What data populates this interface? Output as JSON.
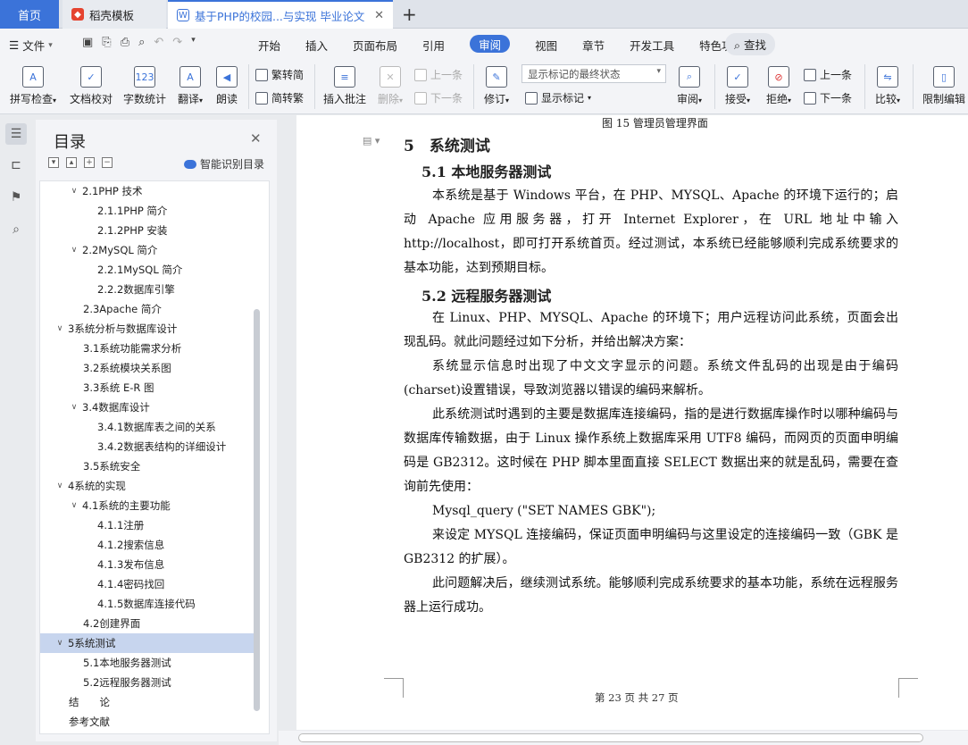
{
  "tabs": {
    "home": "首页",
    "template": "稻壳模板",
    "doc": "基于PHP的校园...与实现 毕业论文"
  },
  "menu": {
    "file": "文件",
    "items": [
      "开始",
      "插入",
      "页面布局",
      "引用",
      "审阅",
      "视图",
      "章节",
      "开发工具",
      "特色功能"
    ],
    "active_index": 4,
    "search": "查找"
  },
  "ribbon": {
    "spell": "拼写检查",
    "proof": "文档校对",
    "count": "字数统计",
    "translate": "翻译",
    "read": "朗读",
    "trad": "繁转简",
    "simp": "简转繁",
    "insert_comment": "插入批注",
    "delete": "删除",
    "prev_comment": "上一条",
    "next_comment": "下一条",
    "revise": "修订",
    "markup_state": "显示标记的最终状态",
    "show_markup": "显示标记",
    "review": "审阅",
    "accept": "接受",
    "reject": "拒绝",
    "prev_change": "上一条",
    "next_change": "下一条",
    "compare": "比较",
    "restrict": "限制编辑"
  },
  "toc": {
    "title": "目录",
    "smart": "智能识别目录",
    "items": [
      {
        "label": "2.1PHP 技术",
        "level": 2,
        "chev": true
      },
      {
        "label": "2.1.1PHP 简介",
        "level": 3,
        "chev": false
      },
      {
        "label": "2.1.2PHP 安装",
        "level": 3,
        "chev": false
      },
      {
        "label": "2.2MySQL 简介",
        "level": 2,
        "chev": true
      },
      {
        "label": "2.2.1MySQL 简介",
        "level": 3,
        "chev": false
      },
      {
        "label": "2.2.2数据库引擎",
        "level": 3,
        "chev": false
      },
      {
        "label": "2.3Apache 简介",
        "level": 2,
        "chev": false
      },
      {
        "label": "3系统分析与数据库设计",
        "level": 1,
        "chev": true
      },
      {
        "label": "3.1系统功能需求分析",
        "level": 2,
        "chev": false
      },
      {
        "label": "3.2系统模块关系图",
        "level": 2,
        "chev": false
      },
      {
        "label": "3.3系统 E-R 图",
        "level": 2,
        "chev": false
      },
      {
        "label": "3.4数据库设计",
        "level": 2,
        "chev": true
      },
      {
        "label": "3.4.1数据库表之间的关系",
        "level": 3,
        "chev": false
      },
      {
        "label": "3.4.2数据表结构的详细设计",
        "level": 3,
        "chev": false
      },
      {
        "label": "3.5系统安全",
        "level": 2,
        "chev": false
      },
      {
        "label": "4系统的实现",
        "level": 1,
        "chev": true
      },
      {
        "label": "4.1系统的主要功能",
        "level": 2,
        "chev": true
      },
      {
        "label": "4.1.1注册",
        "level": 3,
        "chev": false
      },
      {
        "label": "4.1.2搜索信息",
        "level": 3,
        "chev": false
      },
      {
        "label": "4.1.3发布信息",
        "level": 3,
        "chev": false
      },
      {
        "label": "4.1.4密码找回",
        "level": 3,
        "chev": false
      },
      {
        "label": "4.1.5数据库连接代码",
        "level": 3,
        "chev": false
      },
      {
        "label": "4.2创建界面",
        "level": 2,
        "chev": false
      },
      {
        "label": "5系统测试",
        "level": 1,
        "chev": true,
        "selected": true
      },
      {
        "label": "5.1本地服务器测试",
        "level": 2,
        "chev": false
      },
      {
        "label": "5.2远程服务器测试",
        "level": 2,
        "chev": false
      },
      {
        "label": "结　　论",
        "level": 1,
        "chev": false
      },
      {
        "label": "参考文献",
        "level": 1,
        "chev": false
      }
    ]
  },
  "doc": {
    "caption": "图 15 管理员管理界面",
    "h1": "5　系统测试",
    "h2a": "5.1 本地服务器测试",
    "p1": "本系统是基于 Windows 平台，在 PHP、MYSQL、Apache 的环境下运行的；启动 Apache 应用服务器，打开 Internet Explorer，在 URL 地址中输入 http://localhost，即可打开系统首页。经过测试，本系统已经能够顺利完成系统要求的基本功能，达到预期目标。",
    "h2b": "5.2 远程服务器测试",
    "p2": "在 Linux、PHP、MYSQL、Apache 的环境下；用户远程访问此系统，页面会出现乱码。就此问题经过如下分析，并给出解决方案：",
    "p3": "系统显示信息时出现了中文文字显示的问题。系统文件乱码的出现是由于编码(charset)设置错误，导致浏览器以错误的编码来解析。",
    "p4": "此系统测试时遇到的主要是数据库连接编码，指的是进行数据库操作时以哪种编码与数据库传输数据，由于 Linux 操作系统上数据库采用 UTF8 编码，而网页的页面申明编码是 GB2312。这时候在 PHP 脚本里面直接 SELECT 数据出来的就是乱码，需要在查询前先使用：",
    "p5": "Mysql_query (\"SET NAMES GBK\");",
    "p6": "来设定 MYSQL 连接编码，保证页面申明编码与这里设定的连接编码一致（GBK 是 GB2312 的扩展）。",
    "p7": "此问题解决后，继续测试系统。能够顺利完成系统要求的基本功能，系统在远程服务器上运行成功。",
    "page_footer": "第 23 页 共 27 页"
  }
}
